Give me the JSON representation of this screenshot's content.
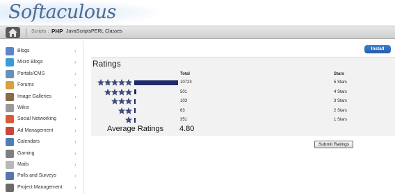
{
  "header": {
    "logo_text": "Softaculous"
  },
  "nav": {
    "scripts_label": "Scripts :",
    "links": [
      "PHP",
      "JavaScripts",
      "PERL",
      "Classes"
    ]
  },
  "sidebar": {
    "items": [
      {
        "label": "Blogs",
        "icon": "blogs-icon",
        "color": "#5b86c9"
      },
      {
        "label": "Micro Blogs",
        "icon": "micro-blogs-icon",
        "color": "#3b9ad9"
      },
      {
        "label": "Portals/CMS",
        "icon": "portals-icon",
        "color": "#6a8fb8"
      },
      {
        "label": "Forums",
        "icon": "forums-icon",
        "color": "#d9a13b"
      },
      {
        "label": "Image Galleries",
        "icon": "image-galleries-icon",
        "color": "#8b6a4a"
      },
      {
        "label": "Wikis",
        "icon": "wikis-icon",
        "color": "#9a9a9a"
      },
      {
        "label": "Social Networking",
        "icon": "social-networking-icon",
        "color": "#d85c3c"
      },
      {
        "label": "Ad Management",
        "icon": "ad-management-icon",
        "color": "#c9463c"
      },
      {
        "label": "Calendars",
        "icon": "calendars-icon",
        "color": "#4f7fb5"
      },
      {
        "label": "Gaming",
        "icon": "gaming-icon",
        "color": "#7f7f7f"
      },
      {
        "label": "Mails",
        "icon": "mails-icon",
        "color": "#b9b9b9"
      },
      {
        "label": "Polls and Surveys",
        "icon": "polls-icon",
        "color": "#5577aa"
      },
      {
        "label": "Project Management",
        "icon": "project-management-icon",
        "color": "#6b6b6b"
      }
    ]
  },
  "install_button": "Install",
  "ratings": {
    "title": "Ratings",
    "col_total": "Total",
    "col_stars": "Stars",
    "rows": [
      {
        "stars": 5,
        "total": "10723",
        "label": "5 Stars",
        "fraction": 1.0
      },
      {
        "stars": 4,
        "total": "501",
        "label": "4 Stars",
        "fraction": 0.047
      },
      {
        "stars": 3,
        "total": "103",
        "label": "3 Stars",
        "fraction": 0.01
      },
      {
        "stars": 2,
        "total": "63",
        "label": "2 Stars",
        "fraction": 0.006
      },
      {
        "stars": 1,
        "total": "351",
        "label": "1 Stars",
        "fraction": 0.033
      }
    ],
    "average_label": "Average Ratings",
    "average_value": "4.80",
    "submit_button": "Submit Ratings"
  },
  "colors": {
    "bar": "#1f2a6b",
    "star": "#3f4e7f"
  }
}
